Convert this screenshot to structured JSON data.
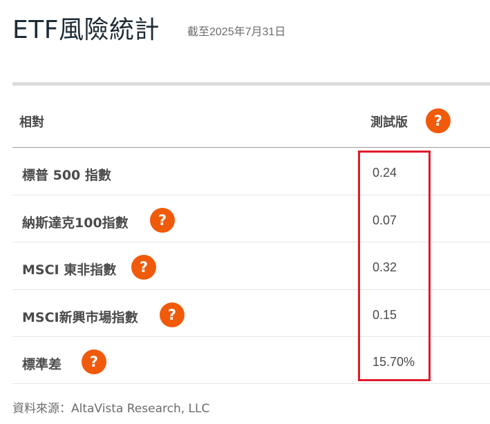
{
  "page": {
    "title": "ETF風險統計",
    "as_of": "截至2025年7月31日"
  },
  "table": {
    "header": {
      "relative_label": "相對",
      "beta_label": "測試版",
      "help_icon_text": "?"
    },
    "rows": [
      {
        "label": "標普 500 指數",
        "value": "0.24",
        "has_help": false
      },
      {
        "label": "納斯達克100指數",
        "value": "0.07",
        "has_help": true
      },
      {
        "label": "MSCI 東非指數",
        "value": "0.32",
        "has_help": true
      },
      {
        "label": "MSCI新興市場指數",
        "value": "0.15",
        "has_help": true
      },
      {
        "label": "標準差",
        "value": "15.70%",
        "has_help": true
      }
    ]
  },
  "footer": {
    "source": "資料來源：AltaVista Research, LLC"
  },
  "colors": {
    "help_icon": "#f05a0a",
    "highlight_border": "#e01a2b",
    "title": "#1e2b35"
  },
  "icons": {
    "help": "question-mark-circle-icon"
  }
}
